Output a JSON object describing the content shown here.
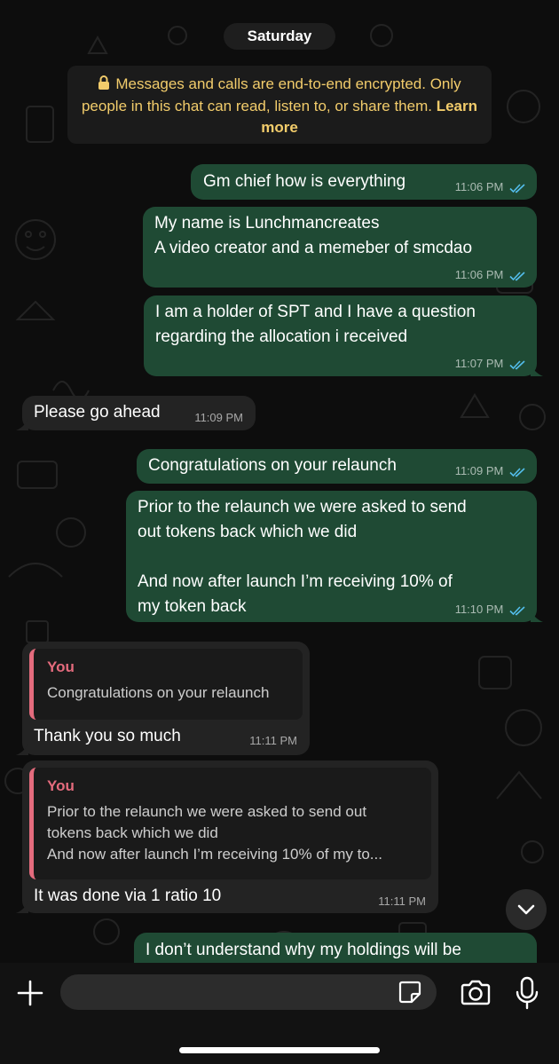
{
  "date_separator": "Saturday",
  "encryption_notice": {
    "text": "Messages and calls are end-to-end encrypted. Only people in this chat can read, listen to, or share them.",
    "link": "Learn more"
  },
  "messages": [
    {
      "direction": "outgoing",
      "text": "Gm chief how is everything",
      "time": "11:06 PM",
      "status": "read"
    },
    {
      "direction": "outgoing",
      "text": "My name is Lunchmancreates\nA video creator and a memeber of smcdao",
      "time": "11:06 PM",
      "status": "read"
    },
    {
      "direction": "outgoing",
      "text": "I am a holder of SPT and I have a question\nregarding the allocation i received",
      "time": "11:07 PM",
      "status": "read"
    },
    {
      "direction": "incoming",
      "text": "Please go ahead",
      "time": "11:09 PM"
    },
    {
      "direction": "outgoing",
      "text": "Congratulations on your relaunch",
      "time": "11:09 PM",
      "status": "read"
    },
    {
      "direction": "outgoing",
      "text": "Prior to the relaunch we were asked to send\nout tokens back which we did\n\nAnd now after launch I’m receiving 10% of\nmy token back",
      "time": "11:10 PM",
      "status": "read"
    },
    {
      "direction": "incoming",
      "quote": {
        "author": "You",
        "text": "Congratulations on your relaunch"
      },
      "text": "Thank you so much",
      "time": "11:11 PM"
    },
    {
      "direction": "incoming",
      "quote": {
        "author": "You",
        "text": "Prior to the relaunch we were asked to send out\ntokens back which we did\nAnd now after launch I’m receiving 10% of my to..."
      },
      "text": "It was done via 1 ratio 10",
      "time": "11:11 PM"
    },
    {
      "direction": "outgoing",
      "text": "I don’t understand why my holdings will be"
    }
  ],
  "composer": {
    "placeholder": "",
    "icons": [
      "plus-icon",
      "sticker-icon",
      "camera-icon",
      "microphone-icon"
    ]
  },
  "colors": {
    "outgoing_bubble": "#1f4a34",
    "incoming_bubble": "#232323",
    "encryption_text": "#f2cc6b",
    "quote_accent": "#e46b7d",
    "read_ticks": "#53bdeb"
  }
}
